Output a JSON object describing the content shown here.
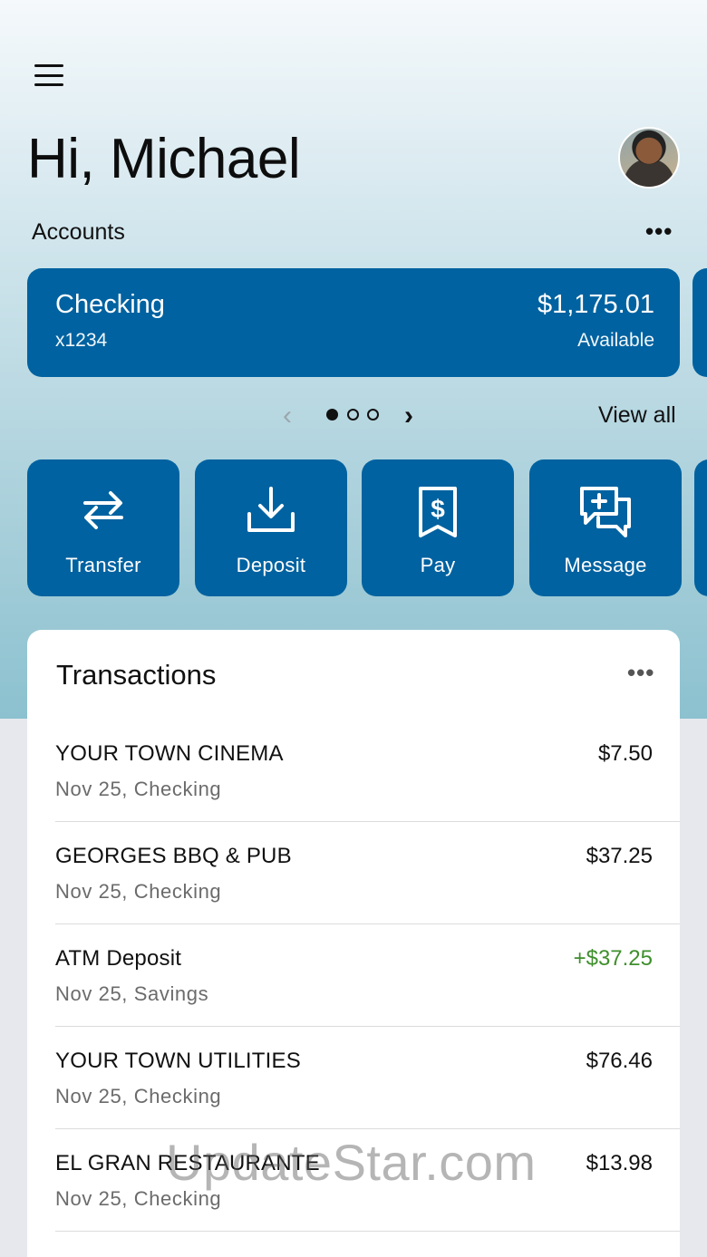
{
  "header": {
    "greeting": "Hi, Michael"
  },
  "accounts": {
    "label": "Accounts",
    "more": "•••",
    "card": {
      "name": "Checking",
      "number": "x1234",
      "balance": "$1,175.01",
      "balance_label": "Available"
    },
    "pager": {
      "prev": "‹",
      "next": "›",
      "page_count": 3,
      "active_page": 1
    },
    "view_all": "View all"
  },
  "actions": [
    {
      "label": "Transfer",
      "icon": "transfer-icon"
    },
    {
      "label": "Deposit",
      "icon": "deposit-icon"
    },
    {
      "label": "Pay",
      "icon": "pay-bill-icon"
    },
    {
      "label": "Message",
      "icon": "message-icon"
    }
  ],
  "transactions": {
    "title": "Transactions",
    "more": "•••",
    "items": [
      {
        "merchant": "YOUR TOWN CINEMA",
        "meta": "Nov 25, Checking",
        "amount": "$7.50",
        "type": "debit"
      },
      {
        "merchant": "GEORGES BBQ & PUB",
        "meta": "Nov 25, Checking",
        "amount": "$37.25",
        "type": "debit"
      },
      {
        "merchant": "ATM Deposit",
        "meta": "Nov 25, Savings",
        "amount": "+$37.25",
        "type": "credit"
      },
      {
        "merchant": "YOUR TOWN UTILITIES",
        "meta": "Nov 25, Checking",
        "amount": "$76.46",
        "type": "debit"
      },
      {
        "merchant": "EL GRAN RESTAURANTE",
        "meta": "Nov 25, Checking",
        "amount": "$13.98",
        "type": "debit"
      }
    ]
  },
  "watermark": "UpdateStar.com",
  "colors": {
    "brand": "#0062a0",
    "credit": "#3e8f2c"
  }
}
